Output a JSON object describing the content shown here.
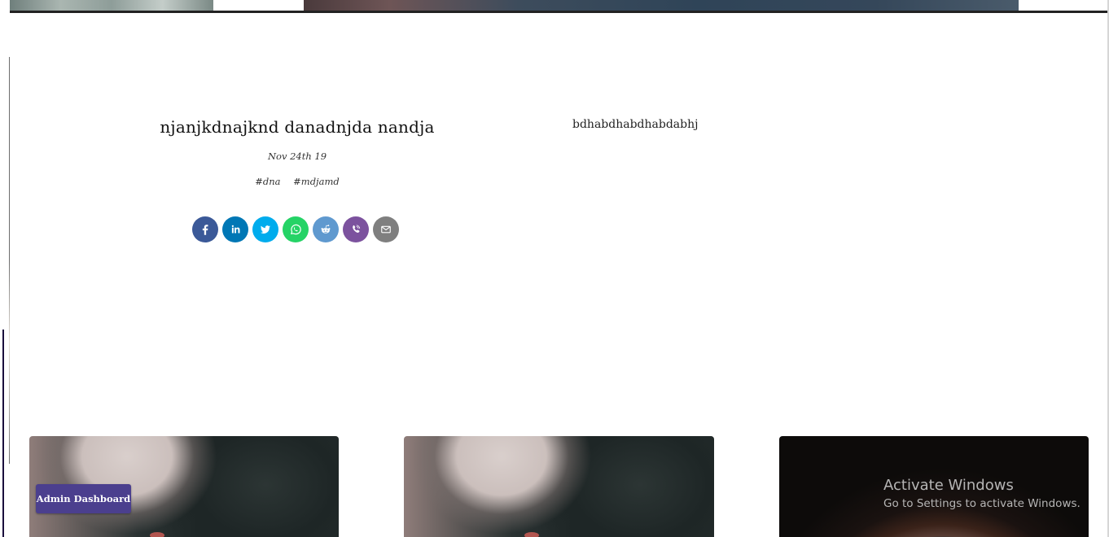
{
  "article": {
    "title": "njanjkdnajknd danadnjda nandja",
    "date": "Nov 24th 19",
    "tags": [
      "#dna",
      "#mdjamd"
    ]
  },
  "side_text": "bdhabdhabdhabdabhj",
  "share": [
    {
      "name": "facebook-icon",
      "color": "#3b5998"
    },
    {
      "name": "linkedin-icon",
      "color": "#0077b5"
    },
    {
      "name": "twitter-icon",
      "color": "#00aced"
    },
    {
      "name": "whatsapp-icon",
      "color": "#25d366"
    },
    {
      "name": "reddit-icon",
      "color": "#5f99cf"
    },
    {
      "name": "viber-icon",
      "color": "#7c529e"
    },
    {
      "name": "email-icon",
      "color": "#7f7f7f"
    }
  ],
  "admin_button": "Admin Dashboard",
  "watermark": {
    "title": "Activate Windows",
    "subtitle": "Go to Settings to activate Windows."
  }
}
